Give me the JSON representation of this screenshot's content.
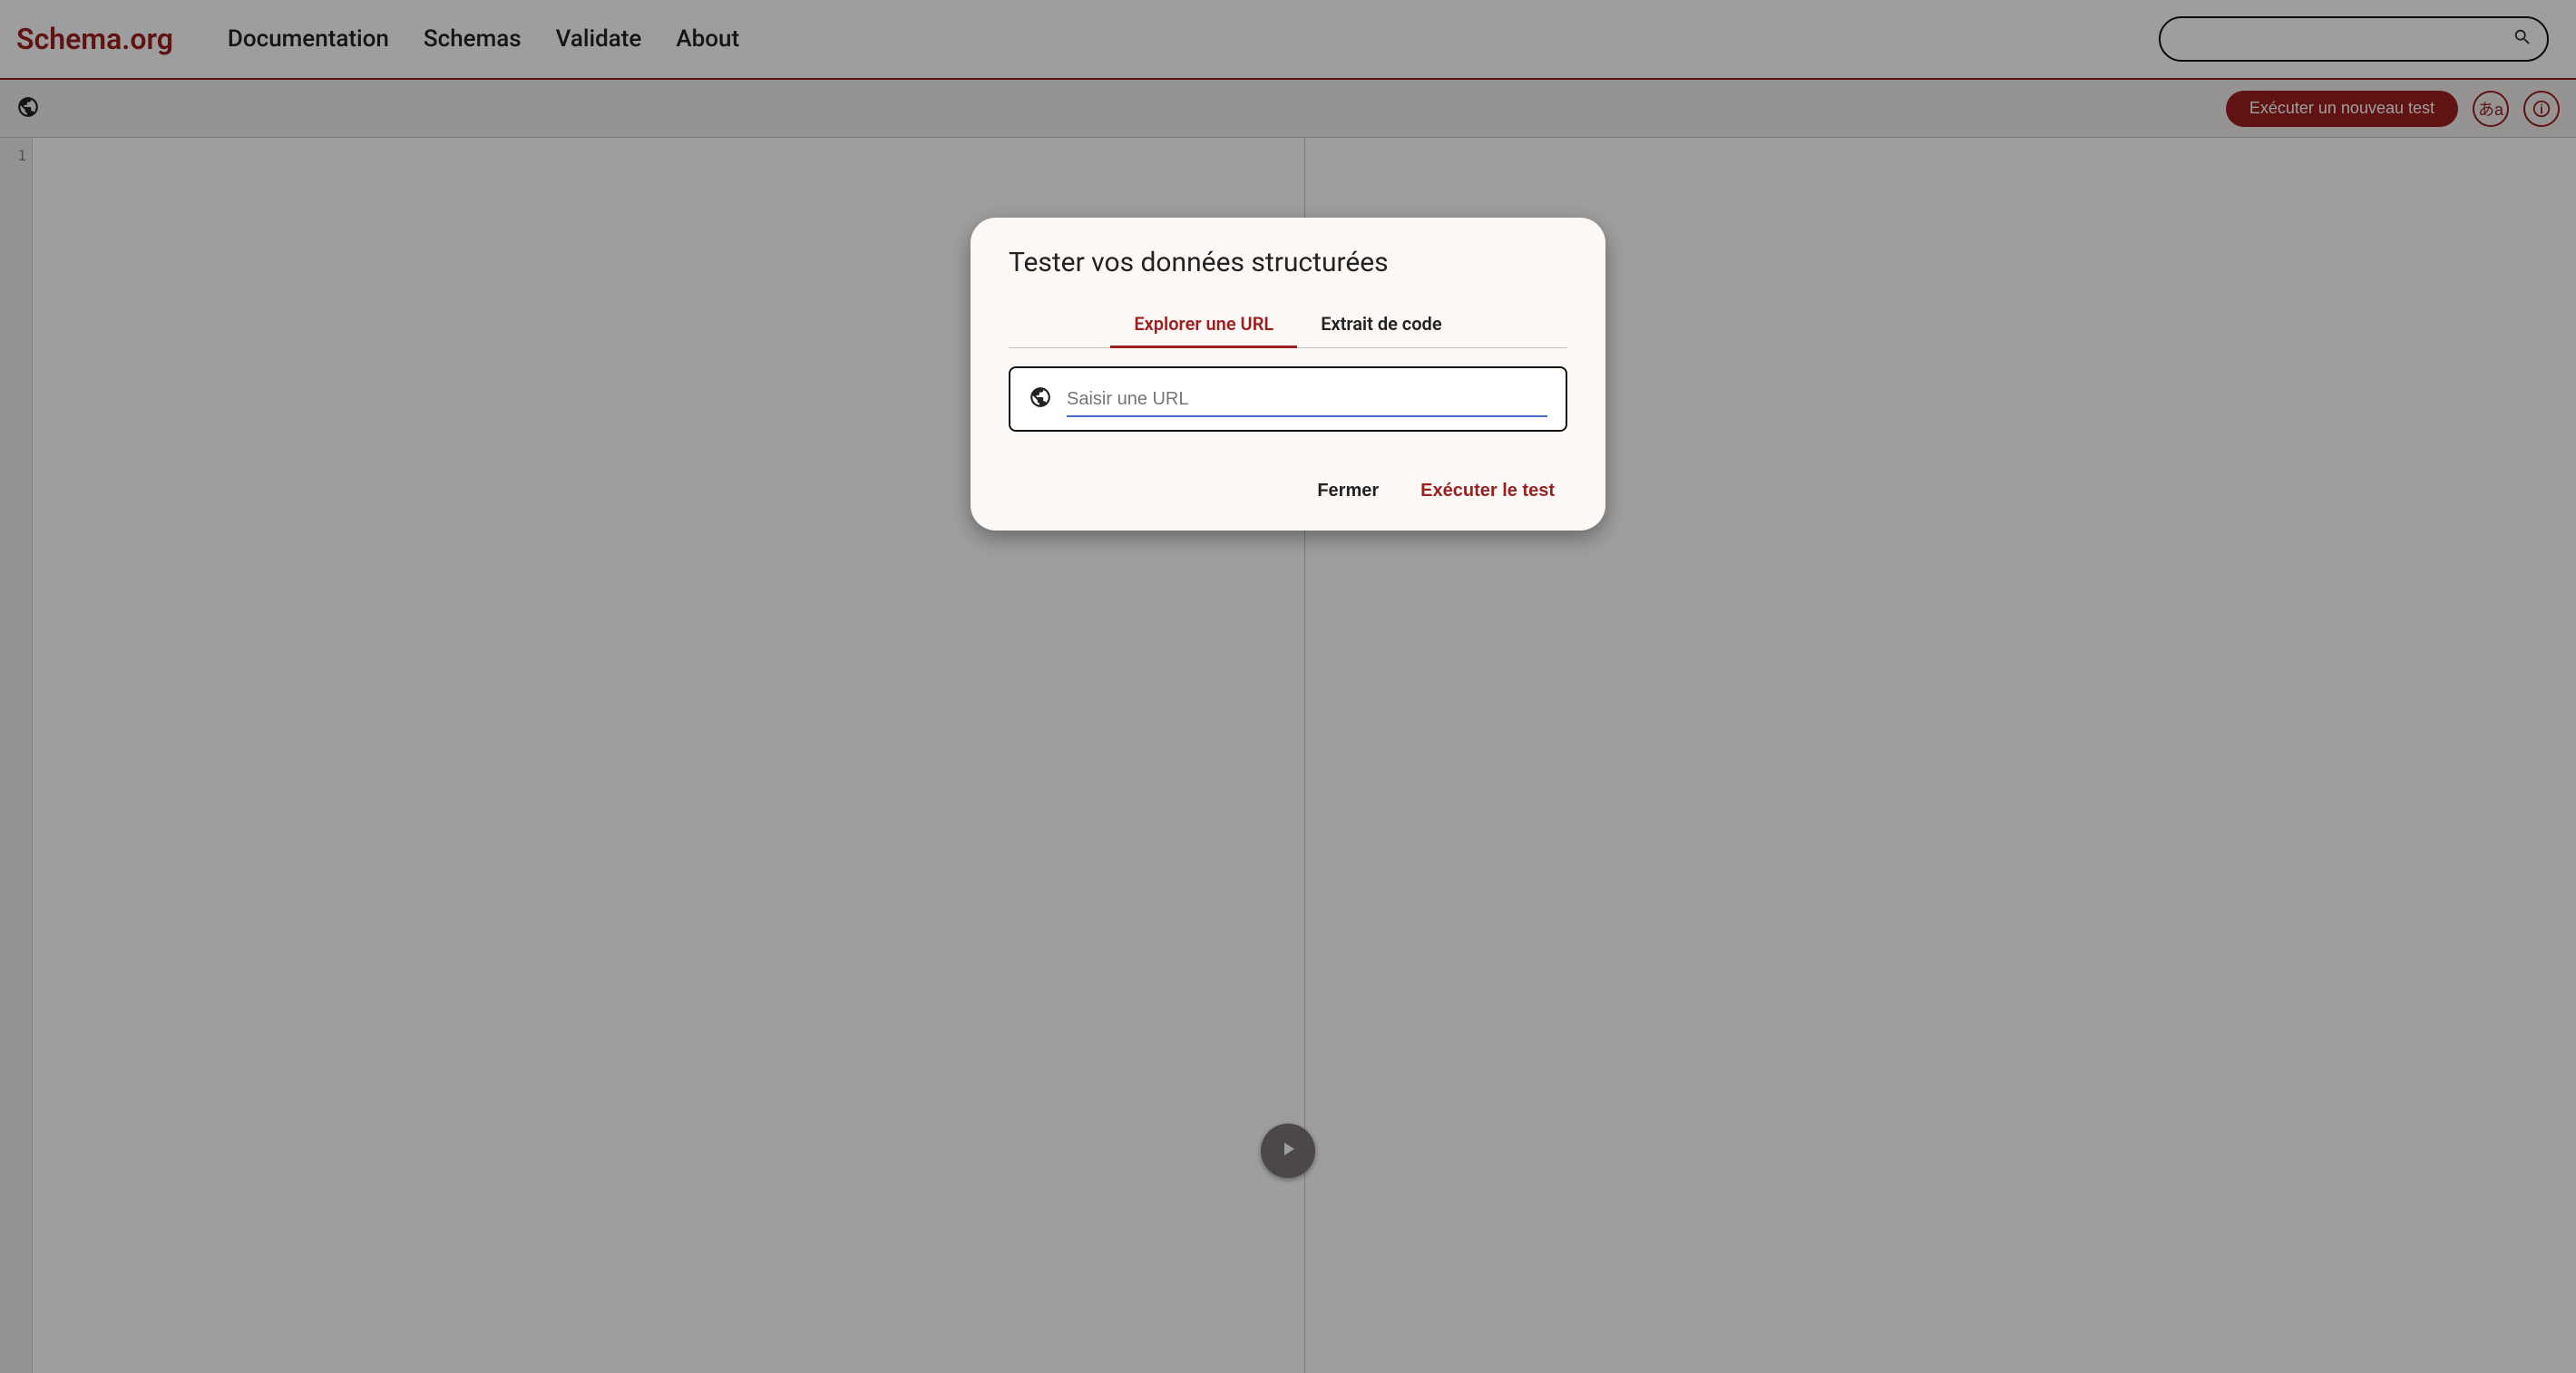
{
  "header": {
    "logo": "Schema.org",
    "nav": {
      "documentation": "Documentation",
      "schemas": "Schemas",
      "validate": "Validate",
      "about": "About"
    },
    "search_placeholder": ""
  },
  "toolbar": {
    "new_test_label": "Exécuter un nouveau test",
    "language_label": "あa"
  },
  "editor": {
    "line_number": "1"
  },
  "dialog": {
    "title": "Tester vos données structurées",
    "tab_url": "Explorer une URL",
    "tab_snippet": "Extrait de code",
    "url_placeholder": "Saisir une URL",
    "close_label": "Fermer",
    "run_label": "Exécuter le test"
  }
}
